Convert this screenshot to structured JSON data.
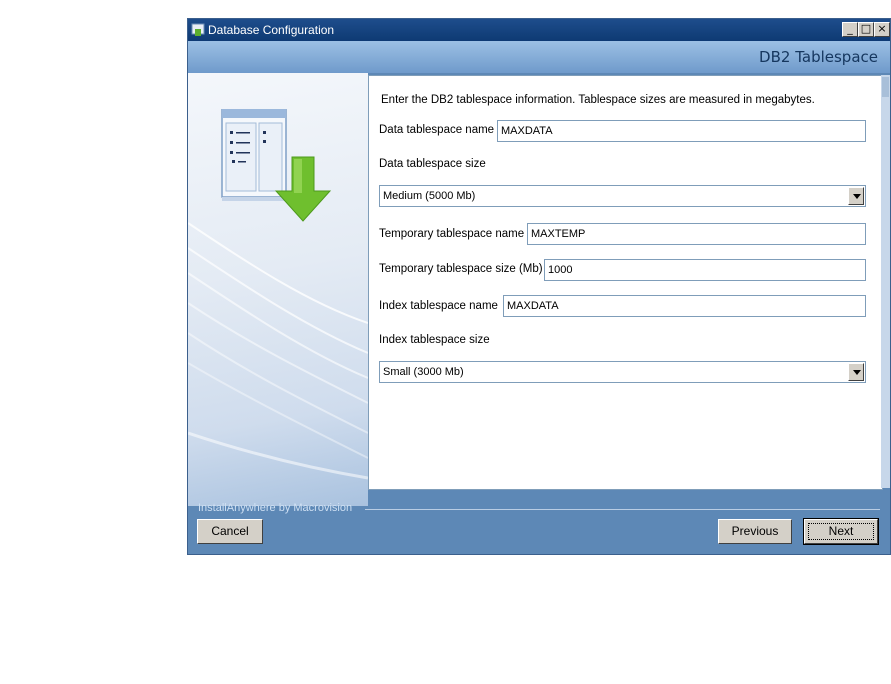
{
  "window": {
    "title": "Database Configuration",
    "controls": {
      "minimize": "_",
      "maximize": "□",
      "close": "×"
    }
  },
  "header": {
    "step_title": "DB2 Tablespace"
  },
  "form": {
    "intro": "Enter the DB2 tablespace information. Tablespace sizes are measured in megabytes.",
    "data_name_label": "Data tablespace name",
    "data_name_value": "MAXDATA",
    "data_size_label": "Data tablespace size",
    "data_size_selected": "Medium (5000 Mb)",
    "temp_name_label": "Temporary tablespace name",
    "temp_name_value": "MAXTEMP",
    "temp_size_label": "Temporary tablespace size (Mb)",
    "temp_size_value": "1000",
    "index_name_label": "Index tablespace name",
    "index_name_value": "MAXDATA",
    "index_size_label": "Index tablespace size",
    "index_size_selected": "Small (3000 Mb)"
  },
  "footer": {
    "brand": "InstallAnywhere by Macrovision",
    "cancel_label": "Cancel",
    "previous_label": "Previous",
    "next_label": "Next"
  },
  "icons": {
    "app": "installer-icon",
    "illustration": "database-download-arrow-icon"
  },
  "colors": {
    "titlebar": "#0e3a73",
    "header_band": "#7fa6d2",
    "frame": "#5d88b6",
    "arrow": "#6fbf2e"
  }
}
